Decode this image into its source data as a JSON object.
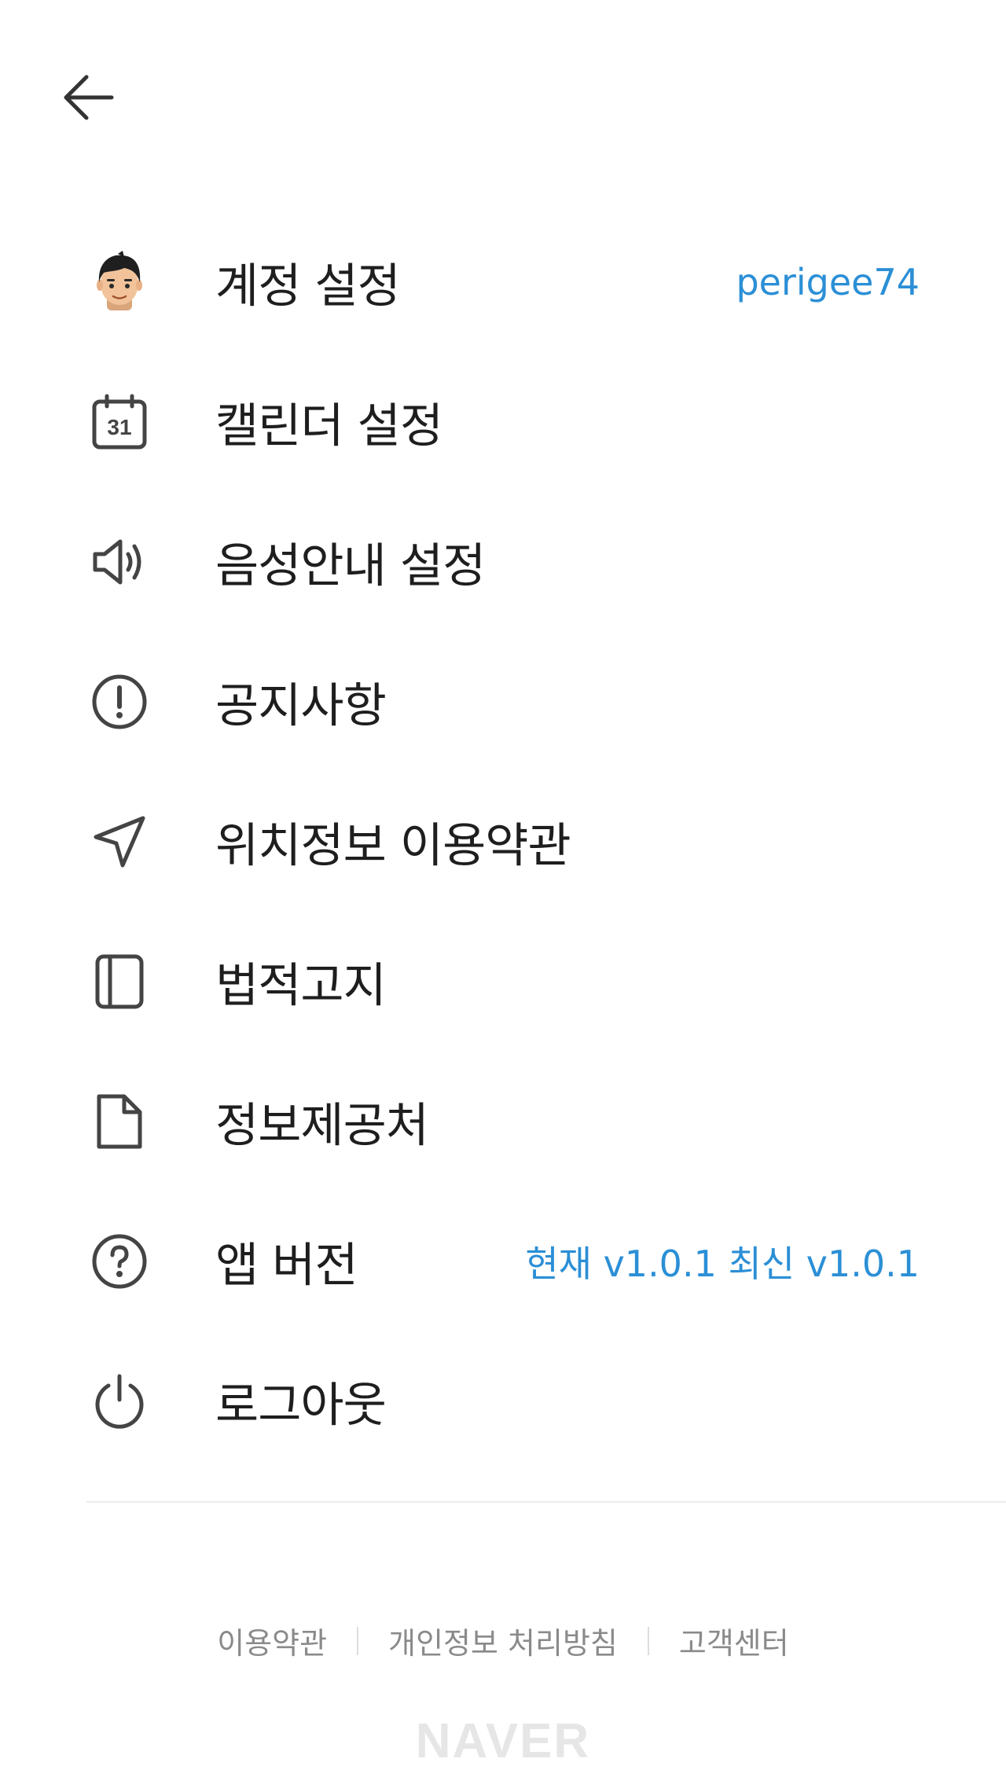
{
  "header": {
    "back_icon": "arrow-left-icon"
  },
  "menu": {
    "items": [
      {
        "icon": "avatar-icon",
        "label": "계정 설정",
        "value": "perigee74"
      },
      {
        "icon": "calendar-icon",
        "label": "캘린더 설정",
        "calendar_day": "31"
      },
      {
        "icon": "speaker-icon",
        "label": "음성안내 설정"
      },
      {
        "icon": "info-circle-icon",
        "label": "공지사항"
      },
      {
        "icon": "navigation-arrow-icon",
        "label": "위치정보 이용약관"
      },
      {
        "icon": "book-icon",
        "label": "법적고지"
      },
      {
        "icon": "document-icon",
        "label": "정보제공처"
      },
      {
        "icon": "question-circle-icon",
        "label": "앱 버전",
        "value": "현재 v1.0.1 최신 v1.0.1"
      },
      {
        "icon": "power-icon",
        "label": "로그아웃"
      }
    ]
  },
  "footer": {
    "links": [
      "이용약관",
      "개인정보 처리방침",
      "고객센터"
    ],
    "logo": "NAVER"
  },
  "colors": {
    "accent": "#2b8fd6",
    "text": "#1e1e1e",
    "muted": "#8a8a8a",
    "icon": "#444444"
  }
}
